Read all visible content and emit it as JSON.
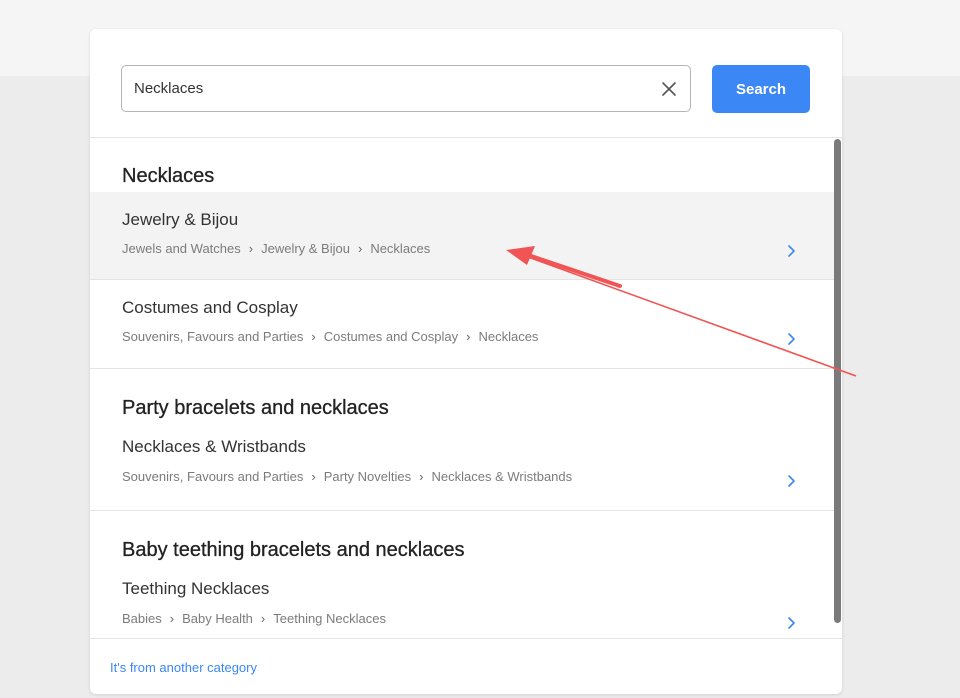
{
  "search": {
    "value": "Necklaces",
    "button_label": "Search"
  },
  "groups": [
    {
      "title": "Necklaces",
      "results": [
        {
          "title": "Jewelry & Bijou",
          "path": [
            "Jewels and Watches",
            "Jewelry & Bijou",
            "Necklaces"
          ]
        },
        {
          "title": "Costumes and Cosplay",
          "path": [
            "Souvenirs, Favours and Parties",
            "Costumes and Cosplay",
            "Necklaces"
          ]
        }
      ]
    },
    {
      "title": "Party bracelets and necklaces",
      "results": [
        {
          "title": "Necklaces & Wristbands",
          "path": [
            "Souvenirs, Favours and Parties",
            "Party Novelties",
            "Necklaces & Wristbands"
          ]
        }
      ]
    },
    {
      "title": "Baby teething bracelets and necklaces",
      "results": [
        {
          "title": "Teething Necklaces",
          "path": [
            "Babies",
            "Baby Health",
            "Teething Necklaces"
          ]
        }
      ]
    }
  ],
  "footer": {
    "other_category_link": "It's from another category"
  },
  "colors": {
    "accent": "#3b87f5",
    "annotation_arrow": "#f05454",
    "highlight_row": "#f3f3f3"
  },
  "icons": {
    "clear": "close-icon",
    "chevron": "chevron-right-icon"
  }
}
